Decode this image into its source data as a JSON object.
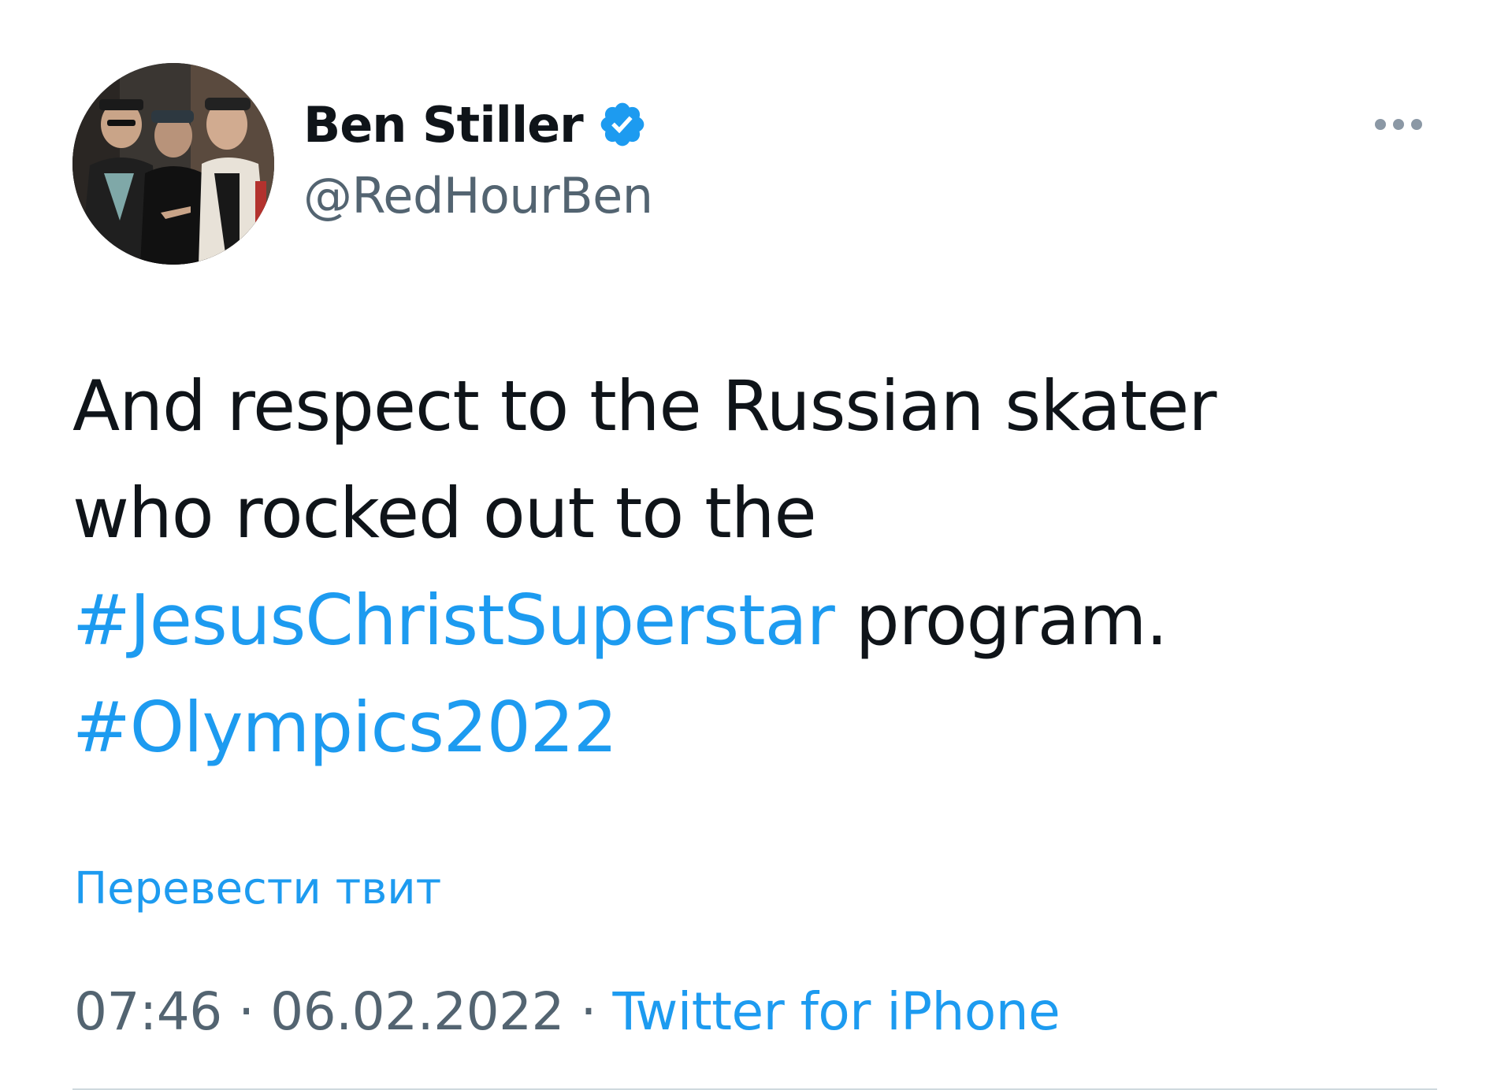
{
  "author": {
    "display_name": "Ben Stiller",
    "handle": "@RedHourBen",
    "verified": true,
    "avatar_icon": "avatar-photo"
  },
  "tweet": {
    "line1": "And respect to the Russian skater",
    "line2": "who rocked out to the",
    "hashtag1": "#JesusChristSuperstar",
    "line3_rest": " program.",
    "hashtag2": "#Olympics2022"
  },
  "translate_label": "Перевести твит",
  "meta": {
    "time": "07:46",
    "separator1": " · ",
    "date": "06.02.2022",
    "separator2": " · ",
    "source": "Twitter for iPhone"
  },
  "icons": {
    "more": "more-horizontal-icon",
    "verified": "verified-badge-icon"
  },
  "colors": {
    "link": "#1d9bf0",
    "text": "#0f1419",
    "secondary": "#536471",
    "verified": "#1d9bf0",
    "divider": "#cfd9de"
  }
}
